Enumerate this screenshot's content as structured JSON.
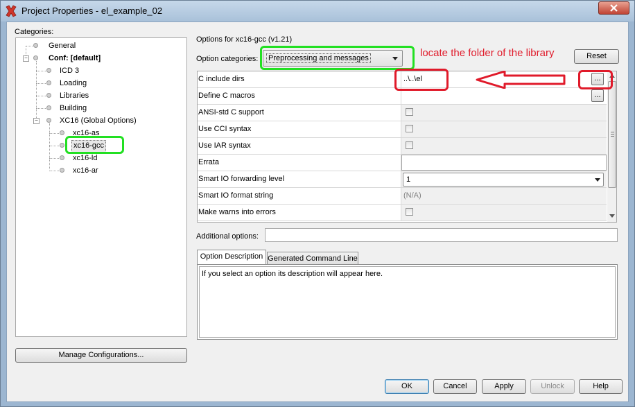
{
  "window": {
    "title": "Project Properties - el_example_02",
    "icon": "red-x-app-icon"
  },
  "categories_label": "Categories:",
  "tree": {
    "general": "General",
    "conf": "Conf: [default]",
    "icd3": "ICD 3",
    "loading": "Loading",
    "libraries": "Libraries",
    "building": "Building",
    "xc16": "XC16 (Global Options)",
    "xc16_as": "xc16-as",
    "xc16_gcc": "xc16-gcc",
    "xc16_ld": "xc16-ld",
    "xc16_ar": "xc16-ar"
  },
  "manage_configurations": "Manage Configurations...",
  "options_for": "Options for xc16-gcc (v1.21)",
  "option_categories_label": "Option categories:",
  "option_category_selected": "Preprocessing and messages",
  "reset": "Reset",
  "annotation": "locate the folder of the library",
  "rows": [
    {
      "name": "C include dirs",
      "value": "..\\..\\el"
    },
    {
      "name": "Define C macros",
      "value": ""
    },
    {
      "name": "ANSI-std C support",
      "value": ""
    },
    {
      "name": "Use CCI syntax",
      "value": ""
    },
    {
      "name": "Use IAR syntax",
      "value": ""
    },
    {
      "name": "Errata",
      "value": ""
    },
    {
      "name": "Smart IO forwarding level",
      "value": "1"
    },
    {
      "name": "Smart IO format string",
      "value": "(N/A)"
    },
    {
      "name": "Make warns into errors",
      "value": ""
    }
  ],
  "browse_label": "...",
  "additional_options_label": "Additional options:",
  "tabs": {
    "option_description": "Option Description",
    "generated_command_line": "Generated Command Line"
  },
  "description_text": "If you select an option its description will appear here.",
  "buttons": {
    "ok": "OK",
    "cancel": "Cancel",
    "apply": "Apply",
    "unlock": "Unlock",
    "help": "Help"
  },
  "colors": {
    "highlight_green": "#22e022",
    "highlight_red": "#e01a2a",
    "annotation_text": "#e01a2a"
  }
}
